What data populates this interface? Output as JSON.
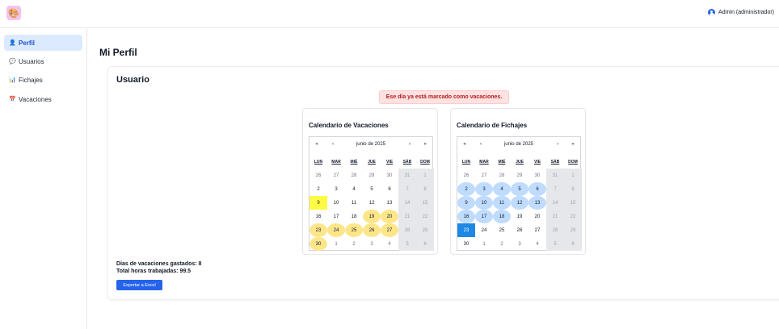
{
  "header": {
    "logo_icon": "app-logo-icon",
    "user_icon": "user-circle-icon",
    "user_label": "Admin (administrador)"
  },
  "sidebar": {
    "items": [
      {
        "icon": "👤",
        "icon_name": "person-icon",
        "label": "Perfil",
        "active": true
      },
      {
        "icon": "💬",
        "icon_name": "speech-bubble-icon",
        "label": "Usuarios",
        "active": false
      },
      {
        "icon": "📊",
        "icon_name": "bar-chart-icon",
        "label": "Fichajes",
        "active": false
      },
      {
        "icon": "📅",
        "icon_name": "calendar-icon",
        "label": "Vacaciones",
        "active": false
      }
    ]
  },
  "main": {
    "page_title": "Mi Perfil",
    "card_title": "Usuario",
    "alert": "Ese día ya está marcado como vacaciones.",
    "calendars": [
      {
        "title": "Calendario de Vacaciones",
        "month_label": "junio de 2025",
        "nav": [
          "«",
          "‹",
          "›",
          "»"
        ],
        "weekdays": [
          "LUN",
          "MAR",
          "MIÉ",
          "JUE",
          "VIE",
          "SÁB",
          "DOM"
        ],
        "weeks": [
          [
            "26",
            "27",
            "28",
            "29",
            "30",
            "31",
            "1"
          ],
          [
            "2",
            "3",
            "4",
            "5",
            "6",
            "7",
            "8"
          ],
          [
            "9",
            "10",
            "11",
            "12",
            "13",
            "14",
            "15"
          ],
          [
            "16",
            "17",
            "18",
            "19",
            "20",
            "21",
            "22"
          ],
          [
            "23",
            "24",
            "25",
            "26",
            "27",
            "28",
            "29"
          ],
          [
            "30",
            "1",
            "2",
            "3",
            "4",
            "5",
            "6"
          ]
        ],
        "highlighted_days": [
          "19",
          "20",
          "23",
          "24",
          "25",
          "26",
          "27",
          "30"
        ],
        "today_day": "9",
        "highlight_color": "#fde68a",
        "today_color": "#fffb44"
      },
      {
        "title": "Calendario de Fichajes",
        "month_label": "junio de 2025",
        "nav": [
          "«",
          "‹",
          "›",
          "»"
        ],
        "weekdays": [
          "LUN",
          "MAR",
          "MIÉ",
          "JUE",
          "VIE",
          "SÁB",
          "DOM"
        ],
        "weeks": [
          [
            "26",
            "27",
            "28",
            "29",
            "30",
            "31",
            "1"
          ],
          [
            "2",
            "3",
            "4",
            "5",
            "6",
            "7",
            "8"
          ],
          [
            "9",
            "10",
            "11",
            "12",
            "13",
            "14",
            "15"
          ],
          [
            "16",
            "17",
            "18",
            "19",
            "20",
            "21",
            "22"
          ],
          [
            "23",
            "24",
            "25",
            "26",
            "27",
            "28",
            "29"
          ],
          [
            "30",
            "1",
            "2",
            "3",
            "4",
            "5",
            "6"
          ]
        ],
        "highlighted_days": [
          "2",
          "3",
          "4",
          "5",
          "6",
          "9",
          "10",
          "11",
          "12",
          "13",
          "16",
          "17",
          "18"
        ],
        "selected_day": "23",
        "highlight_color": "#bfdbfe",
        "selected_color": "#1e88e5"
      }
    ],
    "stats": {
      "vacation_days": "Días de vacaciones gastados: 8",
      "hours_worked": "Total horas trabajadas: 99.5"
    },
    "export_label": "Exportar a Excel"
  },
  "colors": {
    "accent": "#2563eb",
    "alert_bg": "#fee2e2",
    "alert_text": "#b91c1c",
    "sidebar_active_bg": "#dbeafe"
  }
}
